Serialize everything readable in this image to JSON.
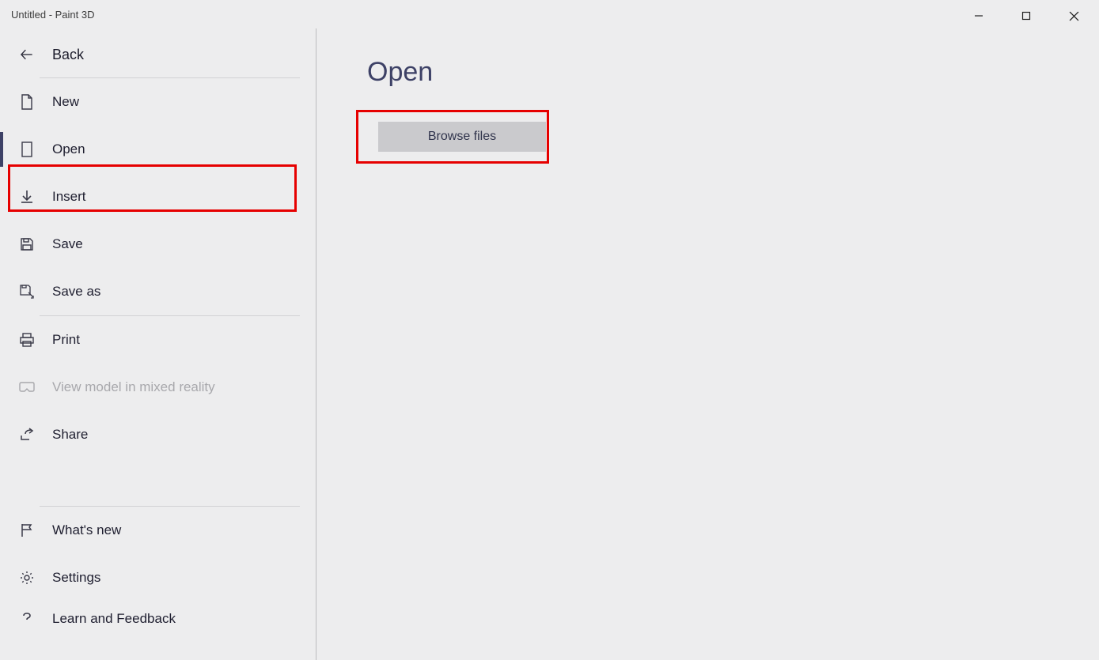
{
  "titlebar": {
    "title": "Untitled - Paint 3D"
  },
  "sidebar": {
    "back": "Back",
    "items": [
      {
        "label": "New"
      },
      {
        "label": "Open",
        "selected": true
      },
      {
        "label": "Insert"
      },
      {
        "label": "Save"
      },
      {
        "label": "Save as"
      },
      {
        "label": "Print"
      },
      {
        "label": "View model in mixed reality",
        "disabled": true
      },
      {
        "label": "Share"
      }
    ],
    "footer": [
      {
        "label": "What's new"
      },
      {
        "label": "Settings"
      },
      {
        "label": "Learn and Feedback"
      }
    ]
  },
  "main": {
    "heading": "Open",
    "browse_label": "Browse files"
  }
}
